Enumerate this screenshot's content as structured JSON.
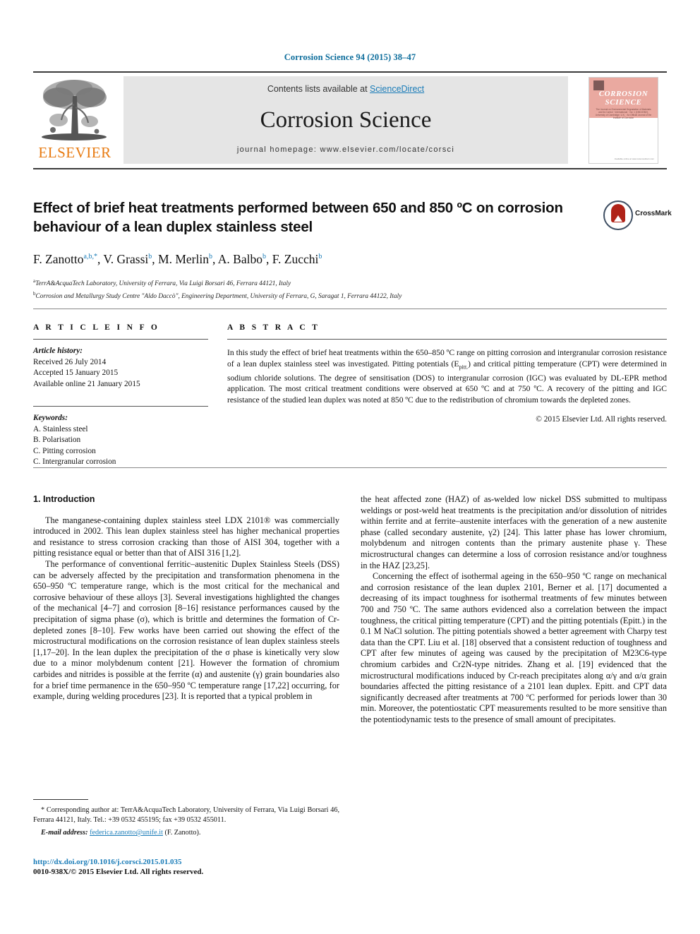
{
  "running_head": "Corrosion Science 94 (2015) 38–47",
  "masthead": {
    "contents_prefix": "Contents lists available at ",
    "contents_link": "ScienceDirect",
    "journal_title": "Corrosion Science",
    "homepage": "journal homepage: www.elsevier.com/locate/corsci",
    "publisher_name": "ELSEVIER",
    "cover": {
      "line1": "CORROSION",
      "line2": "SCIENCE",
      "subtitle": "The Journal on Environmental Degradation of Materials and its Control · International · Vol. 1 (1961/1962), University of Cambridge, U.K. · An Official Journal of the Institute of Corrosion",
      "footer": "Available online at www.sciencedirect.com"
    }
  },
  "article": {
    "title": "Effect of brief heat treatments performed between 650 and 850 ºC on corrosion behaviour of a lean duplex stainless steel",
    "crossmark_label": "CrossMark",
    "authors": [
      {
        "name": "F. Zanotto",
        "marks": "a,b,*"
      },
      {
        "name": "V. Grassi",
        "marks": "b"
      },
      {
        "name": "M. Merlin",
        "marks": "b"
      },
      {
        "name": "A. Balbo",
        "marks": "b"
      },
      {
        "name": "F. Zucchi",
        "marks": "b"
      }
    ],
    "affiliations": [
      {
        "mark": "a",
        "text": "TerrA&AcquaTech Laboratory, University of Ferrara, Via Luigi Borsari 46, Ferrara 44121, Italy"
      },
      {
        "mark": "b",
        "text": "Corrosion and Metallurgy Study Centre \"Aldo Daccò\", Engineering Department, University of Ferrara, G, Saragat 1, Ferrara 44122, Italy"
      }
    ]
  },
  "info": {
    "heading": "A R T I C L E   I N F O",
    "history_label": "Article history:",
    "history": [
      "Received 26 July 2014",
      "Accepted 15 January 2015",
      "Available online 21 January 2015"
    ],
    "keywords_label": "Keywords:",
    "keywords": [
      "A. Stainless steel",
      "B. Polarisation",
      "C. Pitting corrosion",
      "C. Intergranular corrosion"
    ]
  },
  "abstract": {
    "heading": "A B S T R A C T",
    "text_part1": "In this study the effect of brief heat treatments within the 650–850 ºC range on pitting corrosion and intergranular corrosion resistance of a lean duplex stainless steel was investigated. Pitting potentials (E",
    "sub1": "pitt.",
    "text_part2": ") and critical pitting temperature (CPT) were determined in sodium chloride solutions. The degree of sensitisation (DOS) to intergranular corrosion (IGC) was evaluated by DL-EPR method application. The most critical treatment conditions were observed at 650 ºC and at 750 ºC. A recovery of the pitting and IGC resistance of the studied lean duplex was noted at 850 ºC due to the redistribution of chromium towards the depleted zones.",
    "copyright": "© 2015 Elsevier Ltd. All rights reserved."
  },
  "body": {
    "section_title": "1. Introduction",
    "left_paragraphs": [
      "The manganese-containing duplex stainless steel LDX 2101® was commercially introduced in 2002. This lean duplex stainless steel has higher mechanical properties and resistance to stress corrosion cracking than those of AISI 304, together with a pitting resistance equal or better than that of AISI 316 [1,2].",
      "The performance of conventional ferritic–austenitic Duplex Stainless Steels (DSS) can be adversely affected by the precipitation and transformation phenomena in the 650–950 ºC temperature range, which is the most critical for the mechanical and corrosive behaviour of these alloys [3]. Several investigations highlighted the changes of the mechanical [4–7] and corrosion [8–16] resistance performances caused by the precipitation of sigma phase (σ), which is brittle and determines the formation of Cr-depleted zones [8–10]. Few works have been carried out showing the effect of the microstructural modifications on the corrosion resistance of lean duplex stainless steels [1,17–20]. In the lean duplex the precipitation of the σ phase is kinetically very slow due to a minor molybdenum content [21]. However the formation of chromium carbides and nitrides is possible at the ferrite (α) and austenite (γ) grain boundaries also for a brief time permanence in the 650–950 ºC temperature range [17,22] occurring, for example, during welding procedures [23]. It is reported that a typical problem in"
    ],
    "right_paragraphs": [
      "the heat affected zone (HAZ) of as-welded low nickel DSS submitted to multipass weldings or post-weld heat treatments is the precipitation and/or dissolution of nitrides within ferrite and at ferrite–austenite interfaces with the generation of a new austenite phase (called secondary austenite, γ2) [24]. This latter phase has lower chromium, molybdenum and nitrogen contents than the primary austenite phase γ. These microstructural changes can determine a loss of corrosion resistance and/or toughness in the HAZ [23,25].",
      "Concerning the effect of isothermal ageing in the 650–950 ºC range on mechanical and corrosion resistance of the lean duplex 2101, Berner et al. [17] documented a decreasing of its impact toughness for isothermal treatments of few minutes between 700 and 750 ºC. The same authors evidenced also a correlation between the impact toughness, the critical pitting temperature (CPT) and the pitting potentials (Epitt.) in the 0.1 M NaCl solution. The pitting potentials showed a better agreement with Charpy test data than the CPT. Liu et al. [18] observed that a consistent reduction of toughness and CPT after few minutes of ageing was caused by the precipitation of M23C6-type chromium carbides and Cr2N-type nitrides. Zhang et al. [19] evidenced that the microstructural modifications induced by Cr-reach precipitates along α/γ and α/α grain boundaries affected the pitting resistance of a 2101 lean duplex. Epitt. and CPT data significantly decreased after treatments at 700 ºC performed for periods lower than 30 min. Moreover, the potentiostatic CPT measurements resulted to be more sensitive than the potentiodynamic tests to the presence of small amount of precipitates."
    ]
  },
  "footnote": {
    "star": "*",
    "corresponding": "Corresponding author at: TerrA&AcquaTech Laboratory, University of Ferrara, Via Luigi Borsari 46, Ferrara 44121, Italy. Tel.: +39 0532 455195; fax +39 0532 455011.",
    "email_label": "E-mail address:",
    "email": "federica.zanotto@unife.it",
    "email_suffix": "(F. Zanotto)."
  },
  "footer": {
    "doi": "http://dx.doi.org/10.1016/j.corsci.2015.01.035",
    "issn": "0010-938X/© 2015 Elsevier Ltd. All rights reserved."
  },
  "colors": {
    "accent_blue": "#1a7cb8",
    "header_blue": "#0b6c9b",
    "elsevier_orange": "#e87b12",
    "cover_pink": "#eaa9a0",
    "masthead_grey": "#e5e5e5",
    "crossmark_red": "#b02318"
  }
}
